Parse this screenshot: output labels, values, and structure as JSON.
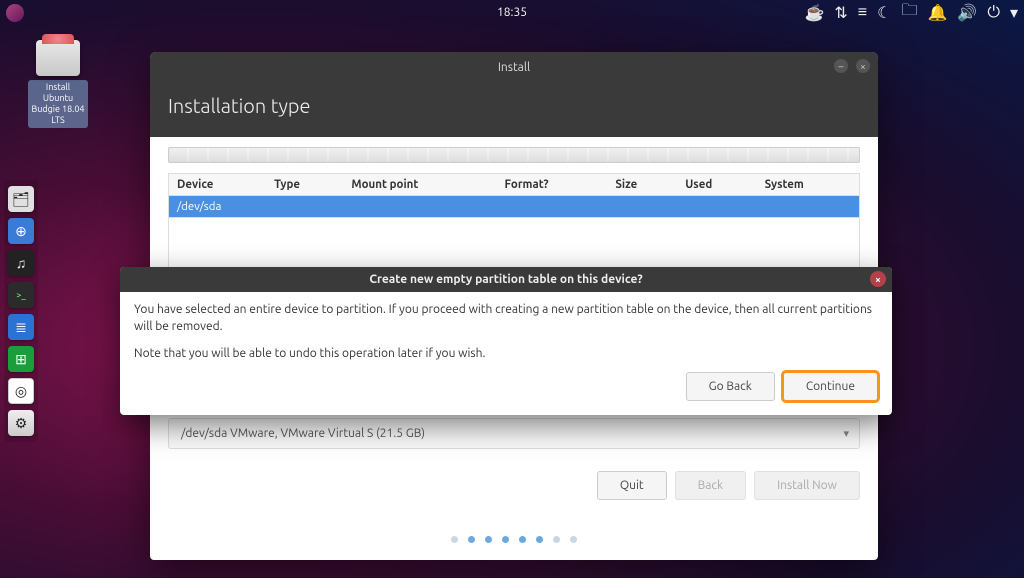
{
  "panel": {
    "clock": "18:35"
  },
  "desktop_icon": {
    "label": "Install Ubuntu Budgie 18.04 LTS"
  },
  "dock": {
    "items": [
      {
        "name": "files",
        "glyph": "🗂"
      },
      {
        "name": "web",
        "glyph": "⊕"
      },
      {
        "name": "music",
        "glyph": "♫"
      },
      {
        "name": "terminal",
        "glyph": ">_"
      },
      {
        "name": "text-editor",
        "glyph": "≣"
      },
      {
        "name": "spreadsheet",
        "glyph": "⊞"
      },
      {
        "name": "browser",
        "glyph": "◎"
      },
      {
        "name": "installer",
        "glyph": "⚙"
      }
    ]
  },
  "window": {
    "title": "Install",
    "heading": "Installation type",
    "columns": [
      "Device",
      "Type",
      "Mount point",
      "Format?",
      "Size",
      "Used",
      "System"
    ],
    "rows": [
      {
        "device": "/dev/sda",
        "type": "",
        "mount": "",
        "format": "",
        "size": "",
        "used": "",
        "system": ""
      }
    ],
    "boot_device": "/dev/sda VMware, VMware Virtual S (21.5 GB)",
    "buttons": {
      "quit": "Quit",
      "back": "Back",
      "install": "Install Now"
    },
    "step": 5,
    "total_steps": 8
  },
  "dialog": {
    "title": "Create new empty partition table on this device?",
    "line1": "You have selected an entire device to partition. If you proceed with creating a new partition table on the device, then all current partitions will be removed.",
    "line2": "Note that you will be able to undo this operation later if you wish.",
    "go_back": "Go Back",
    "continue": "Continue"
  }
}
